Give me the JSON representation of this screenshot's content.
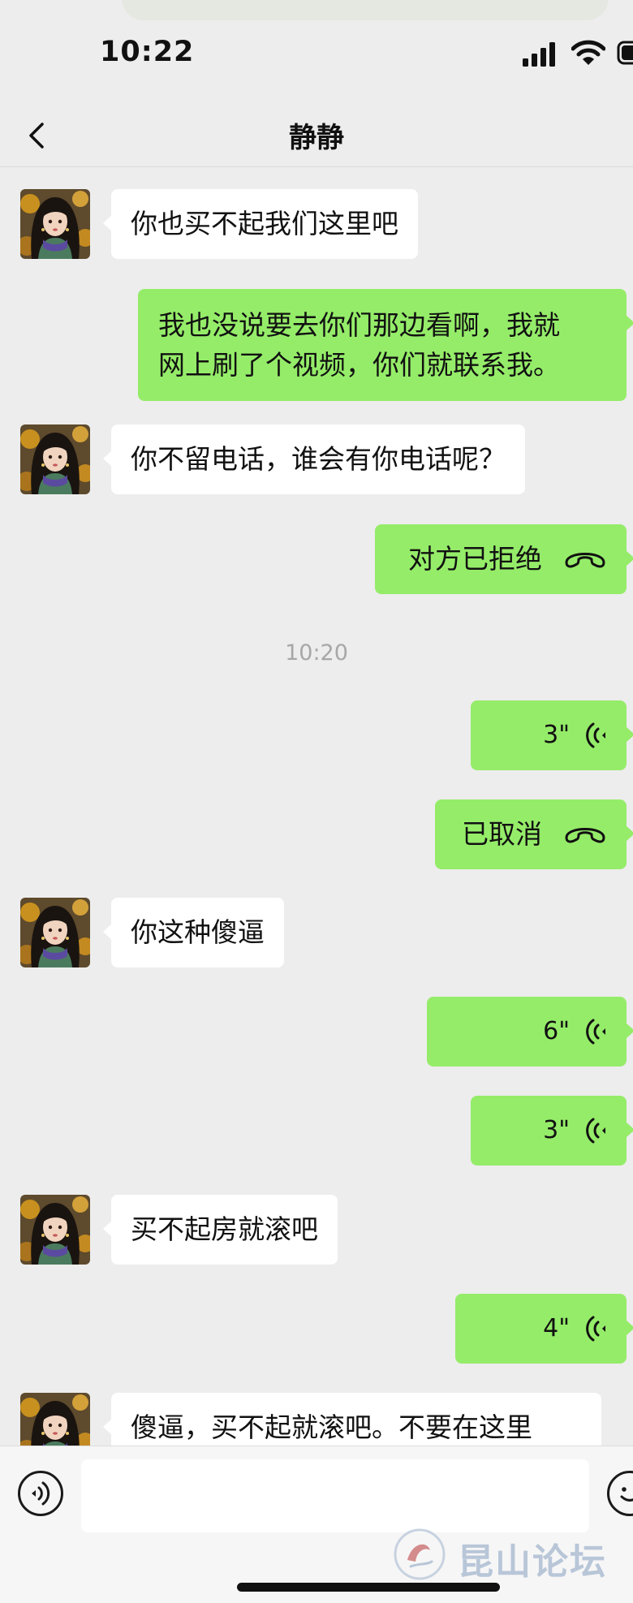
{
  "status_bar": {
    "time": "10:22"
  },
  "header": {
    "title": "静静"
  },
  "messages": [
    {
      "side": "in",
      "type": "text",
      "text": "你也买不起我们这里吧"
    },
    {
      "side": "out",
      "type": "text",
      "lines": [
        "我也没说要去你们那边看啊，我就",
        "网上刷了个视频，你们就联系我。"
      ]
    },
    {
      "side": "in",
      "type": "text",
      "text": "你不留电话，谁会有你电话呢？"
    },
    {
      "side": "out",
      "type": "call",
      "text": "对方已拒绝",
      "icon": "phone-hangup-icon"
    },
    {
      "type": "timestamp",
      "text": "10:20"
    },
    {
      "side": "out",
      "type": "voice",
      "duration": "3\"",
      "icon": "voice-wave-icon"
    },
    {
      "side": "out",
      "type": "call",
      "text": "已取消",
      "icon": "phone-hangup-icon"
    },
    {
      "side": "in",
      "type": "text",
      "text": "你这种傻逼"
    },
    {
      "side": "out",
      "type": "voice",
      "duration": "6\"",
      "icon": "voice-wave-icon"
    },
    {
      "side": "out",
      "type": "voice",
      "duration": "3\"",
      "icon": "voice-wave-icon"
    },
    {
      "side": "in",
      "type": "text",
      "text": "买不起房就滚吧"
    },
    {
      "side": "out",
      "type": "voice",
      "duration": "4\"",
      "icon": "voice-wave-icon"
    },
    {
      "side": "in",
      "type": "text",
      "text": "傻逼，买不起就滚吧。不要在这里"
    }
  ],
  "input_bar": {
    "placeholder": "",
    "value": ""
  },
  "watermark": {
    "text": "昆山论坛"
  },
  "colors": {
    "background": "#ededed",
    "outgoing_bubble": "#95ec69",
    "incoming_bubble": "#ffffff"
  }
}
